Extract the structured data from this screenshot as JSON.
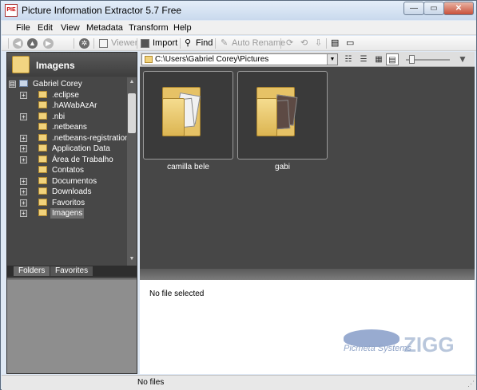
{
  "window": {
    "title": "Picture Information Extractor 5.7 Free",
    "app_icon_label": "PIE",
    "min_glyph": "—",
    "max_glyph": "▭",
    "close_glyph": "✕"
  },
  "menu": [
    "File",
    "Edit",
    "View",
    "Metadata",
    "Transform",
    "Help"
  ],
  "toolbar": {
    "viewer": "Viewer",
    "import": "Import",
    "find": "Find",
    "auto_rename": "Auto Rename"
  },
  "left_panel": {
    "title": "Imagens",
    "tree": [
      {
        "label": "Gabriel Corey",
        "level": 0,
        "expander": "⊟"
      },
      {
        "label": ".eclipse",
        "level": 1,
        "expander": "+"
      },
      {
        "label": ".hAWabAzAr",
        "level": 1,
        "expander": ""
      },
      {
        "label": ".nbi",
        "level": 1,
        "expander": "+"
      },
      {
        "label": ".netbeans",
        "level": 1,
        "expander": ""
      },
      {
        "label": ".netbeans-registration",
        "level": 1,
        "expander": "+"
      },
      {
        "label": "Application Data",
        "level": 1,
        "expander": "+"
      },
      {
        "label": "Área de Trabalho",
        "level": 1,
        "expander": "+"
      },
      {
        "label": "Contatos",
        "level": 1,
        "expander": ""
      },
      {
        "label": "Documentos",
        "level": 1,
        "expander": "+"
      },
      {
        "label": "Downloads",
        "level": 1,
        "expander": "+"
      },
      {
        "label": "Favoritos",
        "level": 1,
        "expander": "+"
      },
      {
        "label": "Imagens",
        "level": 1,
        "expander": "+",
        "selected": true
      }
    ],
    "tabs": [
      "Folders",
      "Favorites"
    ]
  },
  "right_panel": {
    "path": "C:\\Users\\Gabriel Corey\\Pictures",
    "items": [
      {
        "label": "camilla bele"
      },
      {
        "label": "gabi"
      }
    ],
    "info_text": "No file selected"
  },
  "watermark": {
    "brand": "ZIGG",
    "subtitle": "Picmeta Systems"
  },
  "status": {
    "text": "No files"
  }
}
